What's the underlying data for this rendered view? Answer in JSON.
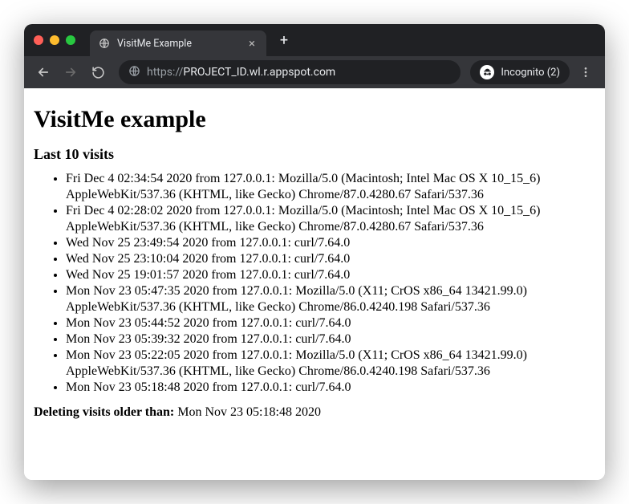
{
  "tab": {
    "title": "VisitMe Example"
  },
  "address": {
    "protocol": "https://",
    "rest": "PROJECT_ID.wl.r.appspot.com"
  },
  "incognito": {
    "label": "Incognito (2)"
  },
  "page": {
    "heading": "VisitMe example",
    "subheading": "Last 10 visits",
    "visits": [
      "Fri Dec 4 02:34:54 2020 from 127.0.0.1: Mozilla/5.0 (Macintosh; Intel Mac OS X 10_15_6) AppleWebKit/537.36 (KHTML, like Gecko) Chrome/87.0.4280.67 Safari/537.36",
      "Fri Dec 4 02:28:02 2020 from 127.0.0.1: Mozilla/5.0 (Macintosh; Intel Mac OS X 10_15_6) AppleWebKit/537.36 (KHTML, like Gecko) Chrome/87.0.4280.67 Safari/537.36",
      "Wed Nov 25 23:49:54 2020 from 127.0.0.1: curl/7.64.0",
      "Wed Nov 25 23:10:04 2020 from 127.0.0.1: curl/7.64.0",
      "Wed Nov 25 19:01:57 2020 from 127.0.0.1: curl/7.64.0",
      "Mon Nov 23 05:47:35 2020 from 127.0.0.1: Mozilla/5.0 (X11; CrOS x86_64 13421.99.0) AppleWebKit/537.36 (KHTML, like Gecko) Chrome/86.0.4240.198 Safari/537.36",
      "Mon Nov 23 05:44:52 2020 from 127.0.0.1: curl/7.64.0",
      "Mon Nov 23 05:39:32 2020 from 127.0.0.1: curl/7.64.0",
      "Mon Nov 23 05:22:05 2020 from 127.0.0.1: Mozilla/5.0 (X11; CrOS x86_64 13421.99.0) AppleWebKit/537.36 (KHTML, like Gecko) Chrome/86.0.4240.198 Safari/537.36",
      "Mon Nov 23 05:18:48 2020 from 127.0.0.1: curl/7.64.0"
    ],
    "deleting_label": "Deleting visits older than:",
    "deleting_value": "Mon Nov 23 05:18:48 2020"
  }
}
